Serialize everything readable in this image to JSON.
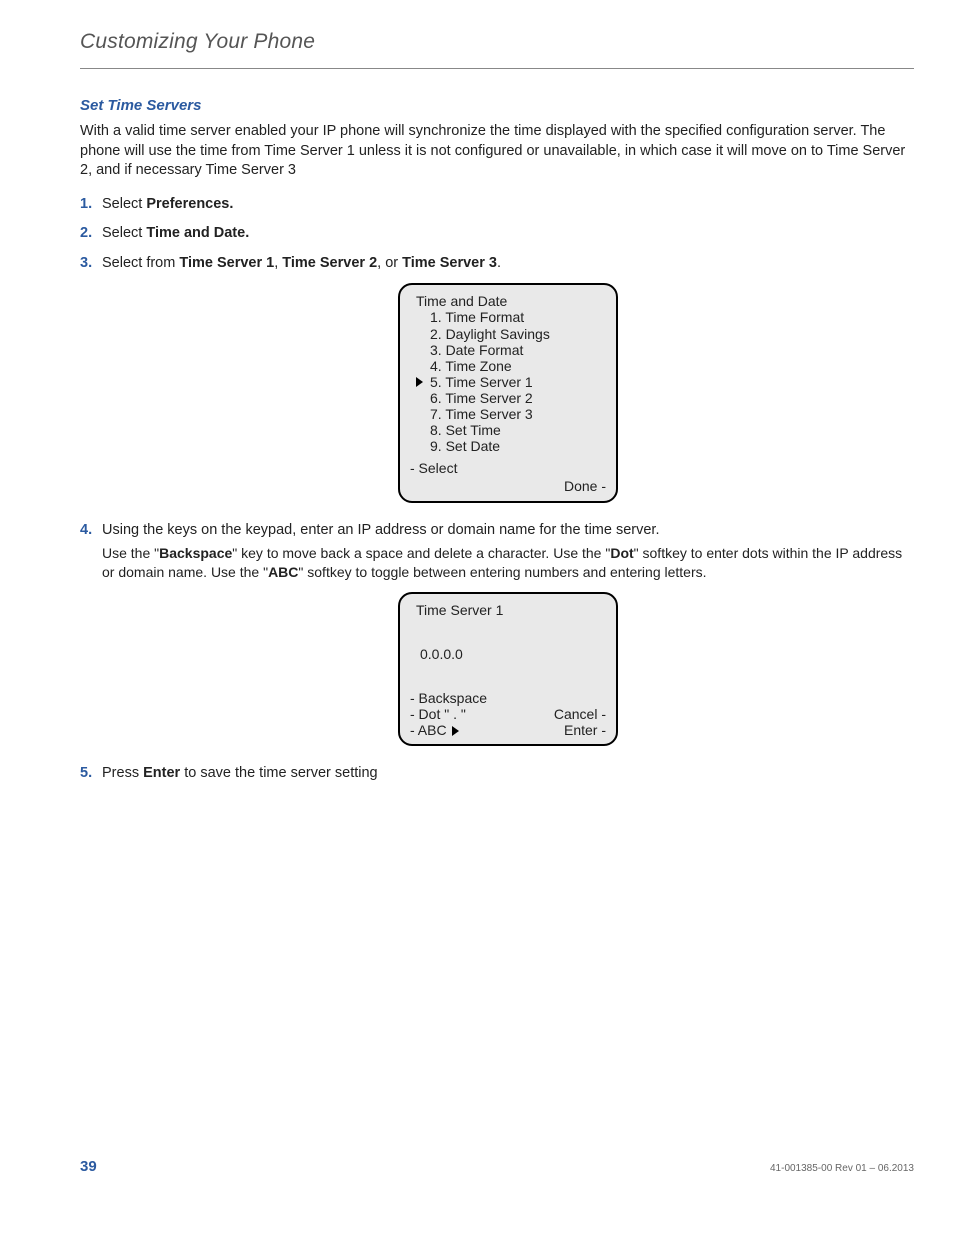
{
  "header": {
    "running_head": "Customizing Your Phone"
  },
  "section": {
    "title": "Set Time Servers",
    "intro": "With a valid time server enabled your IP phone will synchronize the time displayed with the specified configuration server. The phone will use the time from Time Server 1 unless it is not configured or unavailable, in which case it will move on to Time Server 2, and if necessary Time Server 3"
  },
  "steps": {
    "s1_pre": "Select ",
    "s1_bold": "Preferences.",
    "s2_pre": "Select ",
    "s2_bold": "Time and Date.",
    "s3_pre": "Select from ",
    "s3_b1": "Time Server 1",
    "s3_sep1": ", ",
    "s3_b2": "Time Server 2",
    "s3_sep2": ", or ",
    "s3_b3": "Time Server 3",
    "s3_tail": ".",
    "s4_line1": "Using the keys on the keypad, enter an IP address or domain name for the time server.",
    "s4_a": "Use the \"",
    "s4_ab": "Backspace",
    "s4_b": "\" key to move back a space and delete a character. Use the \"",
    "s4_bb": "Dot",
    "s4_c": "\" softkey to enter dots within the IP address or domain name. Use the \"",
    "s4_cb": "ABC",
    "s4_d": "\" softkey to toggle between entering numbers and entering letters.",
    "s5_pre": "Press ",
    "s5_bold": "Enter",
    "s5_post": " to save the time server setting"
  },
  "screen1": {
    "title": "Time and Date",
    "items": [
      "1. Time Format",
      "2. Daylight Savings",
      "3. Date Format",
      "4. Time Zone",
      "5. Time Server 1",
      "6. Time Server 2",
      "7. Time Server 3",
      "8. Set Time",
      "9. Set Date"
    ],
    "selected_index": 4,
    "soft_left": "- Select",
    "soft_right": "Done -"
  },
  "screen2": {
    "title": "Time Server 1",
    "value": "0.0.0.0",
    "left1": "- Backspace",
    "left2": "- Dot \" . \"",
    "left3": "- ABC",
    "right1": "Cancel -",
    "right2": "Enter -"
  },
  "footer": {
    "page": "39",
    "rev": "41-001385-00 Rev 01 – 06.2013"
  }
}
